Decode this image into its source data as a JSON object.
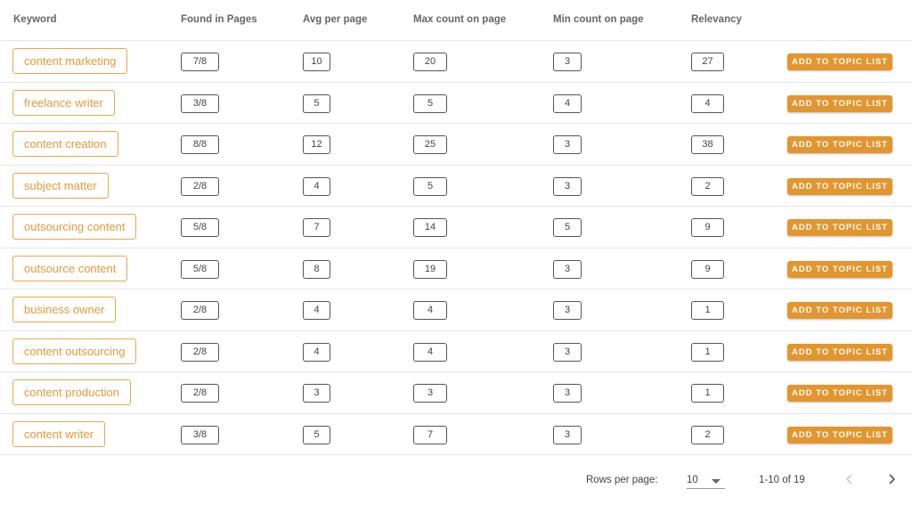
{
  "columns": {
    "keyword": "Keyword",
    "found_in_pages": "Found in Pages",
    "avg_per_page": "Avg per page",
    "max_count": "Max count on page",
    "min_count": "Min count on page",
    "relevancy": "Relevancy"
  },
  "action_label": "ADD TO TOPIC LIST",
  "rows": [
    {
      "keyword": "content marketing",
      "found": "7/8",
      "avg": "10",
      "max": "20",
      "min": "3",
      "relevancy": "27"
    },
    {
      "keyword": "freelance writer",
      "found": "3/8",
      "avg": "5",
      "max": "5",
      "min": "4",
      "relevancy": "4"
    },
    {
      "keyword": "content creation",
      "found": "8/8",
      "avg": "12",
      "max": "25",
      "min": "3",
      "relevancy": "38"
    },
    {
      "keyword": "subject matter",
      "found": "2/8",
      "avg": "4",
      "max": "5",
      "min": "3",
      "relevancy": "2"
    },
    {
      "keyword": "outsourcing content",
      "found": "5/8",
      "avg": "7",
      "max": "14",
      "min": "5",
      "relevancy": "9"
    },
    {
      "keyword": "outsource content",
      "found": "5/8",
      "avg": "8",
      "max": "19",
      "min": "3",
      "relevancy": "9"
    },
    {
      "keyword": "business owner",
      "found": "2/8",
      "avg": "4",
      "max": "4",
      "min": "3",
      "relevancy": "1"
    },
    {
      "keyword": "content outsourcing",
      "found": "2/8",
      "avg": "4",
      "max": "4",
      "min": "3",
      "relevancy": "1"
    },
    {
      "keyword": "content production",
      "found": "2/8",
      "avg": "3",
      "max": "3",
      "min": "3",
      "relevancy": "1"
    },
    {
      "keyword": "content writer",
      "found": "3/8",
      "avg": "5",
      "max": "7",
      "min": "3",
      "relevancy": "2"
    }
  ],
  "pagination": {
    "rows_per_page_label": "Rows per page:",
    "rows_per_page_value": "10",
    "range_text": "1-10 of 19",
    "prev_icon": "chevron-left-icon",
    "next_icon": "chevron-right-icon"
  },
  "colors": {
    "accent": "#e3962f",
    "keyword_border": "#e8a852",
    "keyword_text": "#e39a3a"
  }
}
